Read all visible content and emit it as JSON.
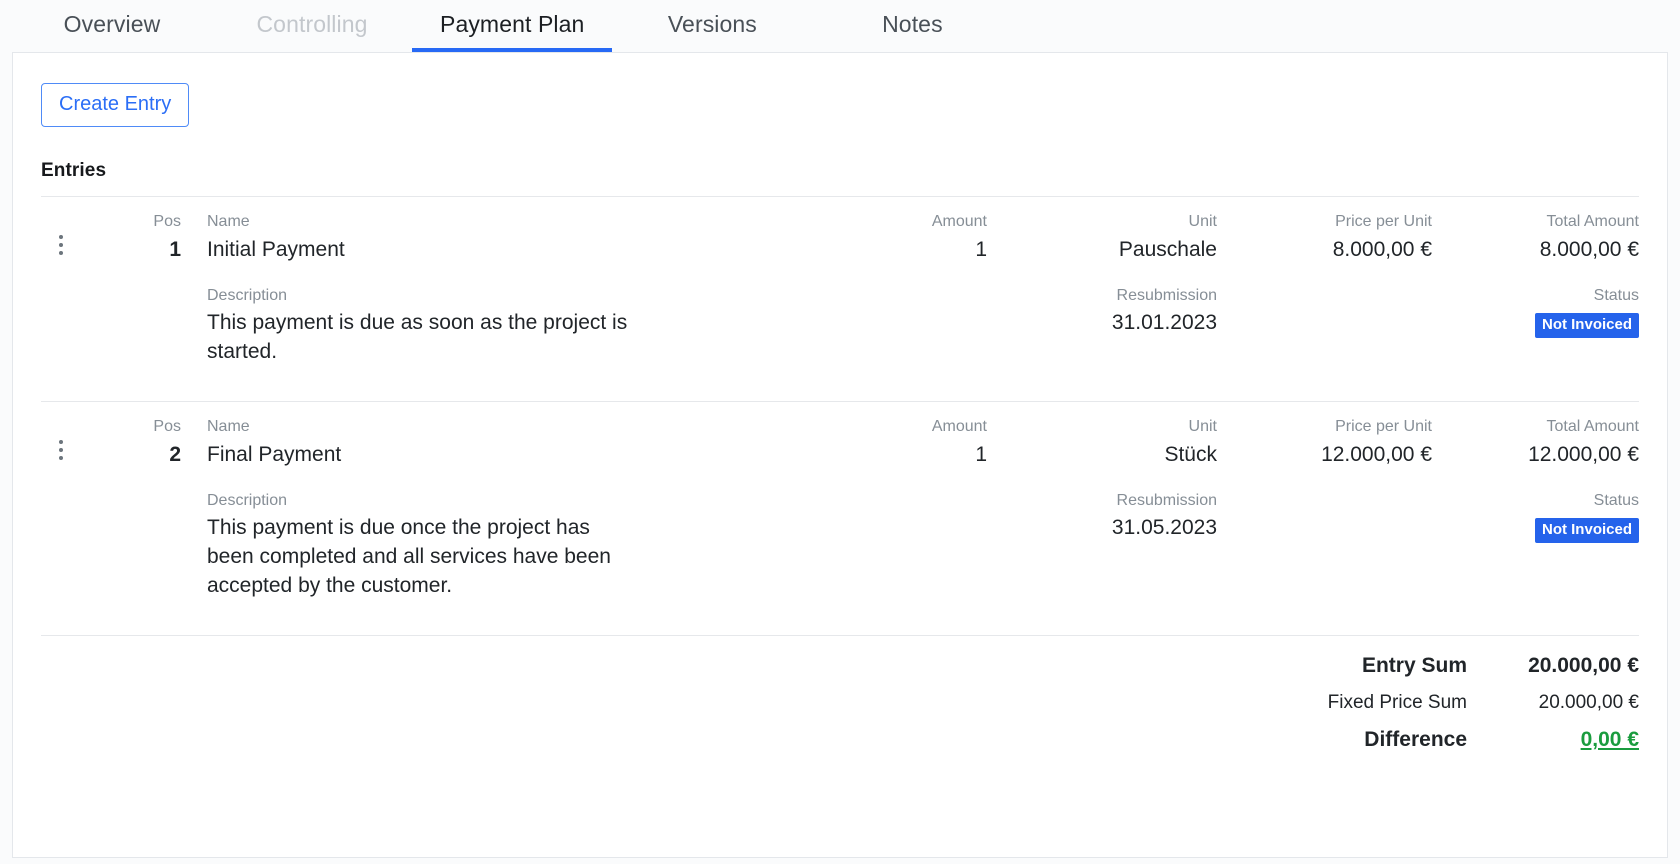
{
  "tabs": [
    {
      "label": "Overview",
      "state": "normal"
    },
    {
      "label": "Controlling",
      "state": "disabled"
    },
    {
      "label": "Payment Plan",
      "state": "active"
    },
    {
      "label": "Versions",
      "state": "normal"
    },
    {
      "label": "Notes",
      "state": "normal"
    }
  ],
  "toolbar": {
    "create_entry_label": "Create Entry"
  },
  "section": {
    "entries_title": "Entries"
  },
  "columns": {
    "pos": "Pos",
    "name": "Name",
    "amount": "Amount",
    "unit": "Unit",
    "price_per_unit": "Price per Unit",
    "total_amount": "Total Amount",
    "description": "Description",
    "resubmission": "Resubmission",
    "status": "Status"
  },
  "entries": [
    {
      "pos": "1",
      "name": "Initial Payment",
      "amount": "1",
      "unit": "Pauschale",
      "price_per_unit": "8.000,00 €",
      "total_amount": "8.000,00 €",
      "description": "This payment is due as soon as the project is started.",
      "resubmission": "31.01.2023",
      "status": "Not Invoiced"
    },
    {
      "pos": "2",
      "name": "Final Payment",
      "amount": "1",
      "unit": "Stück",
      "price_per_unit": "12.000,00 €",
      "total_amount": "12.000,00 €",
      "description": "This payment is due once the project has been completed and all services have been accepted by the customer.",
      "resubmission": "31.05.2023",
      "status": "Not Invoiced"
    }
  ],
  "summary": {
    "entry_sum_label": "Entry Sum",
    "entry_sum_value": "20.000,00 €",
    "fixed_price_sum_label": "Fixed Price Sum",
    "fixed_price_sum_value": "20.000,00 €",
    "difference_label": "Difference",
    "difference_value": "0,00 €"
  },
  "icons": {
    "kebab": "kebab-menu-icon"
  },
  "colors": {
    "accent": "#2769f5",
    "badge_bg": "#2563eb",
    "difference_green": "#1a9c3e",
    "muted_label": "#868e96"
  }
}
